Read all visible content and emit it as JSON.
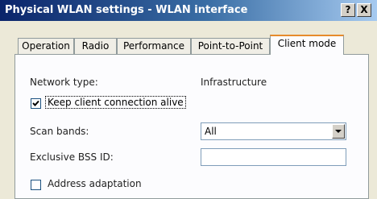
{
  "window": {
    "title": "Physical WLAN settings - WLAN interface",
    "help_button": "?",
    "close_button": "X"
  },
  "tabs": [
    {
      "label": "Operation",
      "active": false
    },
    {
      "label": "Radio",
      "active": false
    },
    {
      "label": "Performance",
      "active": false
    },
    {
      "label": "Point-to-Point",
      "active": false
    },
    {
      "label": "Client mode",
      "active": true
    }
  ],
  "client_mode": {
    "network_type_label": "Network type:",
    "network_type_value": "Infrastructure",
    "keep_alive_label": "Keep client connection alive",
    "keep_alive_checked": true,
    "scan_bands_label": "Scan bands:",
    "scan_bands_value": "All",
    "exclusive_bss_label": "Exclusive BSS ID:",
    "exclusive_bss_value": "",
    "address_adaptation_label": "Address adaptation",
    "address_adaptation_checked": false
  }
}
